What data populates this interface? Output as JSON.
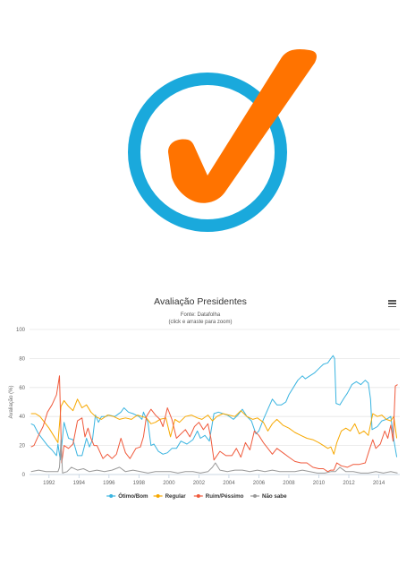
{
  "logo": {
    "icon": "checkmark-in-circle",
    "colors": {
      "ring": "#1aa9dc",
      "check": "#ff7300"
    }
  },
  "chart": {
    "title": "Avaliação Presidentes",
    "subtitle_source": "Fonte: Datafolha",
    "subtitle_hint": "(click e arraste para zoom)",
    "menu_icon": "hamburger-icon"
  },
  "chart_data": {
    "type": "line",
    "title": "Avaliação Presidentes",
    "subtitle": "Fonte: Datafolha (click e arraste para zoom)",
    "xlabel": "",
    "ylabel": "Avaliação (%)",
    "xlim": [
      1990.7,
      2015.4
    ],
    "ylim": [
      0,
      100
    ],
    "yticks": [
      0,
      20,
      40,
      60,
      80,
      100
    ],
    "xticks": [
      "1992",
      "1994",
      "1996",
      "1998",
      "2000",
      "2002",
      "2004",
      "2006",
      "2008",
      "2010",
      "2012",
      "2014"
    ],
    "grid": true,
    "legend_position": "bottom-center",
    "series": [
      {
        "name": "Ótimo/Bom",
        "color": "#3ab4e0",
        "points": [
          [
            1990.8,
            35
          ],
          [
            1991.0,
            34
          ],
          [
            1991.3,
            28
          ],
          [
            1991.6,
            24
          ],
          [
            1991.9,
            20
          ],
          [
            1992.2,
            17
          ],
          [
            1992.5,
            13
          ],
          [
            1992.6,
            21
          ],
          [
            1992.75,
            10
          ],
          [
            1993.0,
            36
          ],
          [
            1993.3,
            25
          ],
          [
            1993.6,
            24
          ],
          [
            1993.9,
            13
          ],
          [
            1994.2,
            13
          ],
          [
            1994.5,
            25
          ],
          [
            1994.7,
            19
          ],
          [
            1994.9,
            24
          ],
          [
            1995.1,
            41
          ],
          [
            1995.3,
            36
          ],
          [
            1995.5,
            40
          ],
          [
            1995.8,
            40
          ],
          [
            1996.0,
            41
          ],
          [
            1996.4,
            40
          ],
          [
            1996.8,
            43
          ],
          [
            1997.0,
            46
          ],
          [
            1997.3,
            43
          ],
          [
            1997.6,
            42
          ],
          [
            1998.0,
            40
          ],
          [
            1998.2,
            38
          ],
          [
            1998.3,
            43
          ],
          [
            1998.6,
            36
          ],
          [
            1998.8,
            20
          ],
          [
            1999.0,
            21
          ],
          [
            1999.3,
            16
          ],
          [
            1999.6,
            14
          ],
          [
            1999.9,
            15
          ],
          [
            2000.2,
            18
          ],
          [
            2000.5,
            18
          ],
          [
            2000.8,
            23
          ],
          [
            2001.2,
            21
          ],
          [
            2001.6,
            24
          ],
          [
            2001.9,
            30
          ],
          [
            2002.1,
            25
          ],
          [
            2002.4,
            27
          ],
          [
            2002.7,
            23
          ],
          [
            2003.0,
            42
          ],
          [
            2003.3,
            43
          ],
          [
            2003.6,
            42
          ],
          [
            2003.9,
            41
          ],
          [
            2004.3,
            38
          ],
          [
            2004.6,
            41
          ],
          [
            2004.9,
            45
          ],
          [
            2005.2,
            40
          ],
          [
            2005.5,
            37
          ],
          [
            2005.8,
            28
          ],
          [
            2006.0,
            30
          ],
          [
            2006.3,
            38
          ],
          [
            2006.6,
            45
          ],
          [
            2006.9,
            52
          ],
          [
            2007.2,
            48
          ],
          [
            2007.5,
            48
          ],
          [
            2007.8,
            50
          ],
          [
            2008.0,
            55
          ],
          [
            2008.3,
            60
          ],
          [
            2008.6,
            65
          ],
          [
            2008.9,
            68
          ],
          [
            2009.1,
            66
          ],
          [
            2009.4,
            68
          ],
          [
            2009.7,
            70
          ],
          [
            2010.0,
            73
          ],
          [
            2010.3,
            76
          ],
          [
            2010.6,
            77
          ],
          [
            2010.8,
            80
          ],
          [
            2010.95,
            82
          ],
          [
            2011.05,
            80
          ],
          [
            2011.15,
            49
          ],
          [
            2011.4,
            48
          ],
          [
            2011.7,
            53
          ],
          [
            2011.9,
            56
          ],
          [
            2012.2,
            62
          ],
          [
            2012.5,
            64
          ],
          [
            2012.8,
            62
          ],
          [
            2013.1,
            65
          ],
          [
            2013.3,
            63
          ],
          [
            2013.45,
            52
          ],
          [
            2013.55,
            31
          ],
          [
            2013.9,
            33
          ],
          [
            2014.2,
            37
          ],
          [
            2014.5,
            38
          ],
          [
            2014.8,
            40
          ],
          [
            2015.0,
            24
          ],
          [
            2015.2,
            12
          ]
        ]
      },
      {
        "name": "Regular",
        "color": "#f7a800",
        "points": [
          [
            1990.8,
            42
          ],
          [
            1991.1,
            42
          ],
          [
            1991.4,
            40
          ],
          [
            1991.7,
            36
          ],
          [
            1992.0,
            32
          ],
          [
            1992.3,
            27
          ],
          [
            1992.6,
            22
          ],
          [
            1992.8,
            47
          ],
          [
            1993.0,
            51
          ],
          [
            1993.3,
            47
          ],
          [
            1993.6,
            44
          ],
          [
            1993.9,
            52
          ],
          [
            1994.2,
            46
          ],
          [
            1994.5,
            48
          ],
          [
            1994.8,
            43
          ],
          [
            1995.1,
            40
          ],
          [
            1995.5,
            38
          ],
          [
            1995.9,
            41
          ],
          [
            1996.3,
            40
          ],
          [
            1996.7,
            38
          ],
          [
            1997.1,
            39
          ],
          [
            1997.5,
            38
          ],
          [
            1997.9,
            41
          ],
          [
            1998.2,
            40
          ],
          [
            1998.5,
            39
          ],
          [
            1998.8,
            35
          ],
          [
            1999.1,
            36
          ],
          [
            1999.4,
            38
          ],
          [
            1999.8,
            39
          ],
          [
            2000.1,
            26
          ],
          [
            2000.4,
            38
          ],
          [
            2000.7,
            36
          ],
          [
            2001.1,
            40
          ],
          [
            2001.5,
            41
          ],
          [
            2001.9,
            39
          ],
          [
            2002.2,
            38
          ],
          [
            2002.6,
            41
          ],
          [
            2002.9,
            37
          ],
          [
            2003.2,
            40
          ],
          [
            2003.6,
            42
          ],
          [
            2004.0,
            41
          ],
          [
            2004.4,
            40
          ],
          [
            2004.8,
            44
          ],
          [
            2005.2,
            40
          ],
          [
            2005.6,
            38
          ],
          [
            2005.9,
            39
          ],
          [
            2006.3,
            36
          ],
          [
            2006.6,
            30
          ],
          [
            2006.9,
            35
          ],
          [
            2007.2,
            38
          ],
          [
            2007.6,
            34
          ],
          [
            2008.0,
            32
          ],
          [
            2008.4,
            29
          ],
          [
            2008.8,
            27
          ],
          [
            2009.2,
            25
          ],
          [
            2009.6,
            24
          ],
          [
            2010.0,
            22
          ],
          [
            2010.3,
            20
          ],
          [
            2010.6,
            18
          ],
          [
            2010.8,
            19
          ],
          [
            2011.0,
            14
          ],
          [
            2011.2,
            22
          ],
          [
            2011.5,
            30
          ],
          [
            2011.8,
            32
          ],
          [
            2012.1,
            30
          ],
          [
            2012.4,
            35
          ],
          [
            2012.7,
            28
          ],
          [
            2013.0,
            30
          ],
          [
            2013.3,
            27
          ],
          [
            2013.6,
            42
          ],
          [
            2013.9,
            40
          ],
          [
            2014.2,
            41
          ],
          [
            2014.5,
            38
          ],
          [
            2014.8,
            37
          ],
          [
            2015.0,
            40
          ],
          [
            2015.2,
            25
          ]
        ]
      },
      {
        "name": "Ruim/Péssimo",
        "color": "#f05a3c",
        "points": [
          [
            1990.8,
            19
          ],
          [
            1991.0,
            20
          ],
          [
            1991.3,
            27
          ],
          [
            1991.6,
            33
          ],
          [
            1991.9,
            43
          ],
          [
            1992.2,
            48
          ],
          [
            1992.5,
            55
          ],
          [
            1992.7,
            68
          ],
          [
            1992.85,
            8
          ],
          [
            1993.0,
            20
          ],
          [
            1993.3,
            18
          ],
          [
            1993.6,
            21
          ],
          [
            1993.9,
            37
          ],
          [
            1994.2,
            39
          ],
          [
            1994.4,
            26
          ],
          [
            1994.6,
            32
          ],
          [
            1994.8,
            25
          ],
          [
            1995.0,
            20
          ],
          [
            1995.2,
            20
          ],
          [
            1995.6,
            11
          ],
          [
            1995.9,
            14
          ],
          [
            1996.2,
            11
          ],
          [
            1996.5,
            14
          ],
          [
            1996.8,
            25
          ],
          [
            1997.1,
            15
          ],
          [
            1997.4,
            11
          ],
          [
            1997.8,
            18
          ],
          [
            1998.1,
            19
          ],
          [
            1998.3,
            26
          ],
          [
            1998.5,
            40
          ],
          [
            1998.8,
            45
          ],
          [
            1999.1,
            41
          ],
          [
            1999.4,
            38
          ],
          [
            1999.6,
            33
          ],
          [
            1999.9,
            46
          ],
          [
            2000.2,
            38
          ],
          [
            2000.5,
            25
          ],
          [
            2000.8,
            28
          ],
          [
            2001.1,
            31
          ],
          [
            2001.4,
            26
          ],
          [
            2001.7,
            33
          ],
          [
            2002.0,
            36
          ],
          [
            2002.3,
            31
          ],
          [
            2002.6,
            35
          ],
          [
            2002.8,
            25
          ],
          [
            2003.0,
            10
          ],
          [
            2003.4,
            16
          ],
          [
            2003.8,
            13
          ],
          [
            2004.2,
            13
          ],
          [
            2004.5,
            18
          ],
          [
            2004.8,
            12
          ],
          [
            2005.1,
            22
          ],
          [
            2005.4,
            17
          ],
          [
            2005.7,
            30
          ],
          [
            2006.0,
            27
          ],
          [
            2006.3,
            22
          ],
          [
            2006.6,
            18
          ],
          [
            2006.9,
            14
          ],
          [
            2007.2,
            18
          ],
          [
            2007.6,
            15
          ],
          [
            2008.0,
            12
          ],
          [
            2008.4,
            9
          ],
          [
            2008.8,
            8
          ],
          [
            2009.2,
            8
          ],
          [
            2009.6,
            5
          ],
          [
            2010.0,
            4
          ],
          [
            2010.3,
            4
          ],
          [
            2010.6,
            2
          ],
          [
            2010.8,
            3
          ],
          [
            2011.0,
            3
          ],
          [
            2011.2,
            8
          ],
          [
            2011.5,
            6
          ],
          [
            2011.9,
            5
          ],
          [
            2012.3,
            7
          ],
          [
            2012.7,
            7
          ],
          [
            2013.1,
            8
          ],
          [
            2013.4,
            18
          ],
          [
            2013.6,
            24
          ],
          [
            2013.8,
            18
          ],
          [
            2014.1,
            21
          ],
          [
            2014.4,
            30
          ],
          [
            2014.6,
            25
          ],
          [
            2014.8,
            34
          ],
          [
            2014.95,
            23
          ],
          [
            2015.1,
            61
          ],
          [
            2015.25,
            62
          ]
        ]
      },
      {
        "name": "Não sabe",
        "color": "#999999",
        "points": [
          [
            1990.8,
            2
          ],
          [
            1991.3,
            3
          ],
          [
            1991.8,
            2
          ],
          [
            1992.3,
            2
          ],
          [
            1992.6,
            2
          ],
          [
            1992.7,
            5
          ],
          [
            1992.8,
            24
          ],
          [
            1992.9,
            1
          ],
          [
            1993.2,
            2
          ],
          [
            1993.5,
            5
          ],
          [
            1993.9,
            3
          ],
          [
            1994.3,
            4
          ],
          [
            1994.7,
            2
          ],
          [
            1995.2,
            3
          ],
          [
            1995.7,
            2
          ],
          [
            1996.2,
            3
          ],
          [
            1996.7,
            5
          ],
          [
            1997.1,
            2
          ],
          [
            1997.6,
            3
          ],
          [
            1998.1,
            2
          ],
          [
            1998.6,
            1
          ],
          [
            1999.1,
            2
          ],
          [
            1999.6,
            2
          ],
          [
            2000.1,
            2
          ],
          [
            2000.6,
            1
          ],
          [
            2001.1,
            2
          ],
          [
            2001.6,
            2
          ],
          [
            2002.1,
            1
          ],
          [
            2002.6,
            2
          ],
          [
            2002.9,
            5
          ],
          [
            2003.1,
            8
          ],
          [
            2003.4,
            3
          ],
          [
            2003.9,
            2
          ],
          [
            2004.4,
            3
          ],
          [
            2004.9,
            3
          ],
          [
            2005.4,
            2
          ],
          [
            2005.9,
            3
          ],
          [
            2006.4,
            2
          ],
          [
            2006.9,
            3
          ],
          [
            2007.4,
            2
          ],
          [
            2007.9,
            2
          ],
          [
            2008.4,
            2
          ],
          [
            2008.9,
            3
          ],
          [
            2009.4,
            2
          ],
          [
            2009.9,
            1
          ],
          [
            2010.4,
            1
          ],
          [
            2010.8,
            2
          ],
          [
            2011.1,
            2
          ],
          [
            2011.4,
            5
          ],
          [
            2011.8,
            2
          ],
          [
            2012.3,
            2
          ],
          [
            2012.8,
            1
          ],
          [
            2013.3,
            1
          ],
          [
            2013.8,
            2
          ],
          [
            2014.3,
            1
          ],
          [
            2014.8,
            2
          ],
          [
            2015.25,
            1
          ]
        ]
      }
    ]
  }
}
